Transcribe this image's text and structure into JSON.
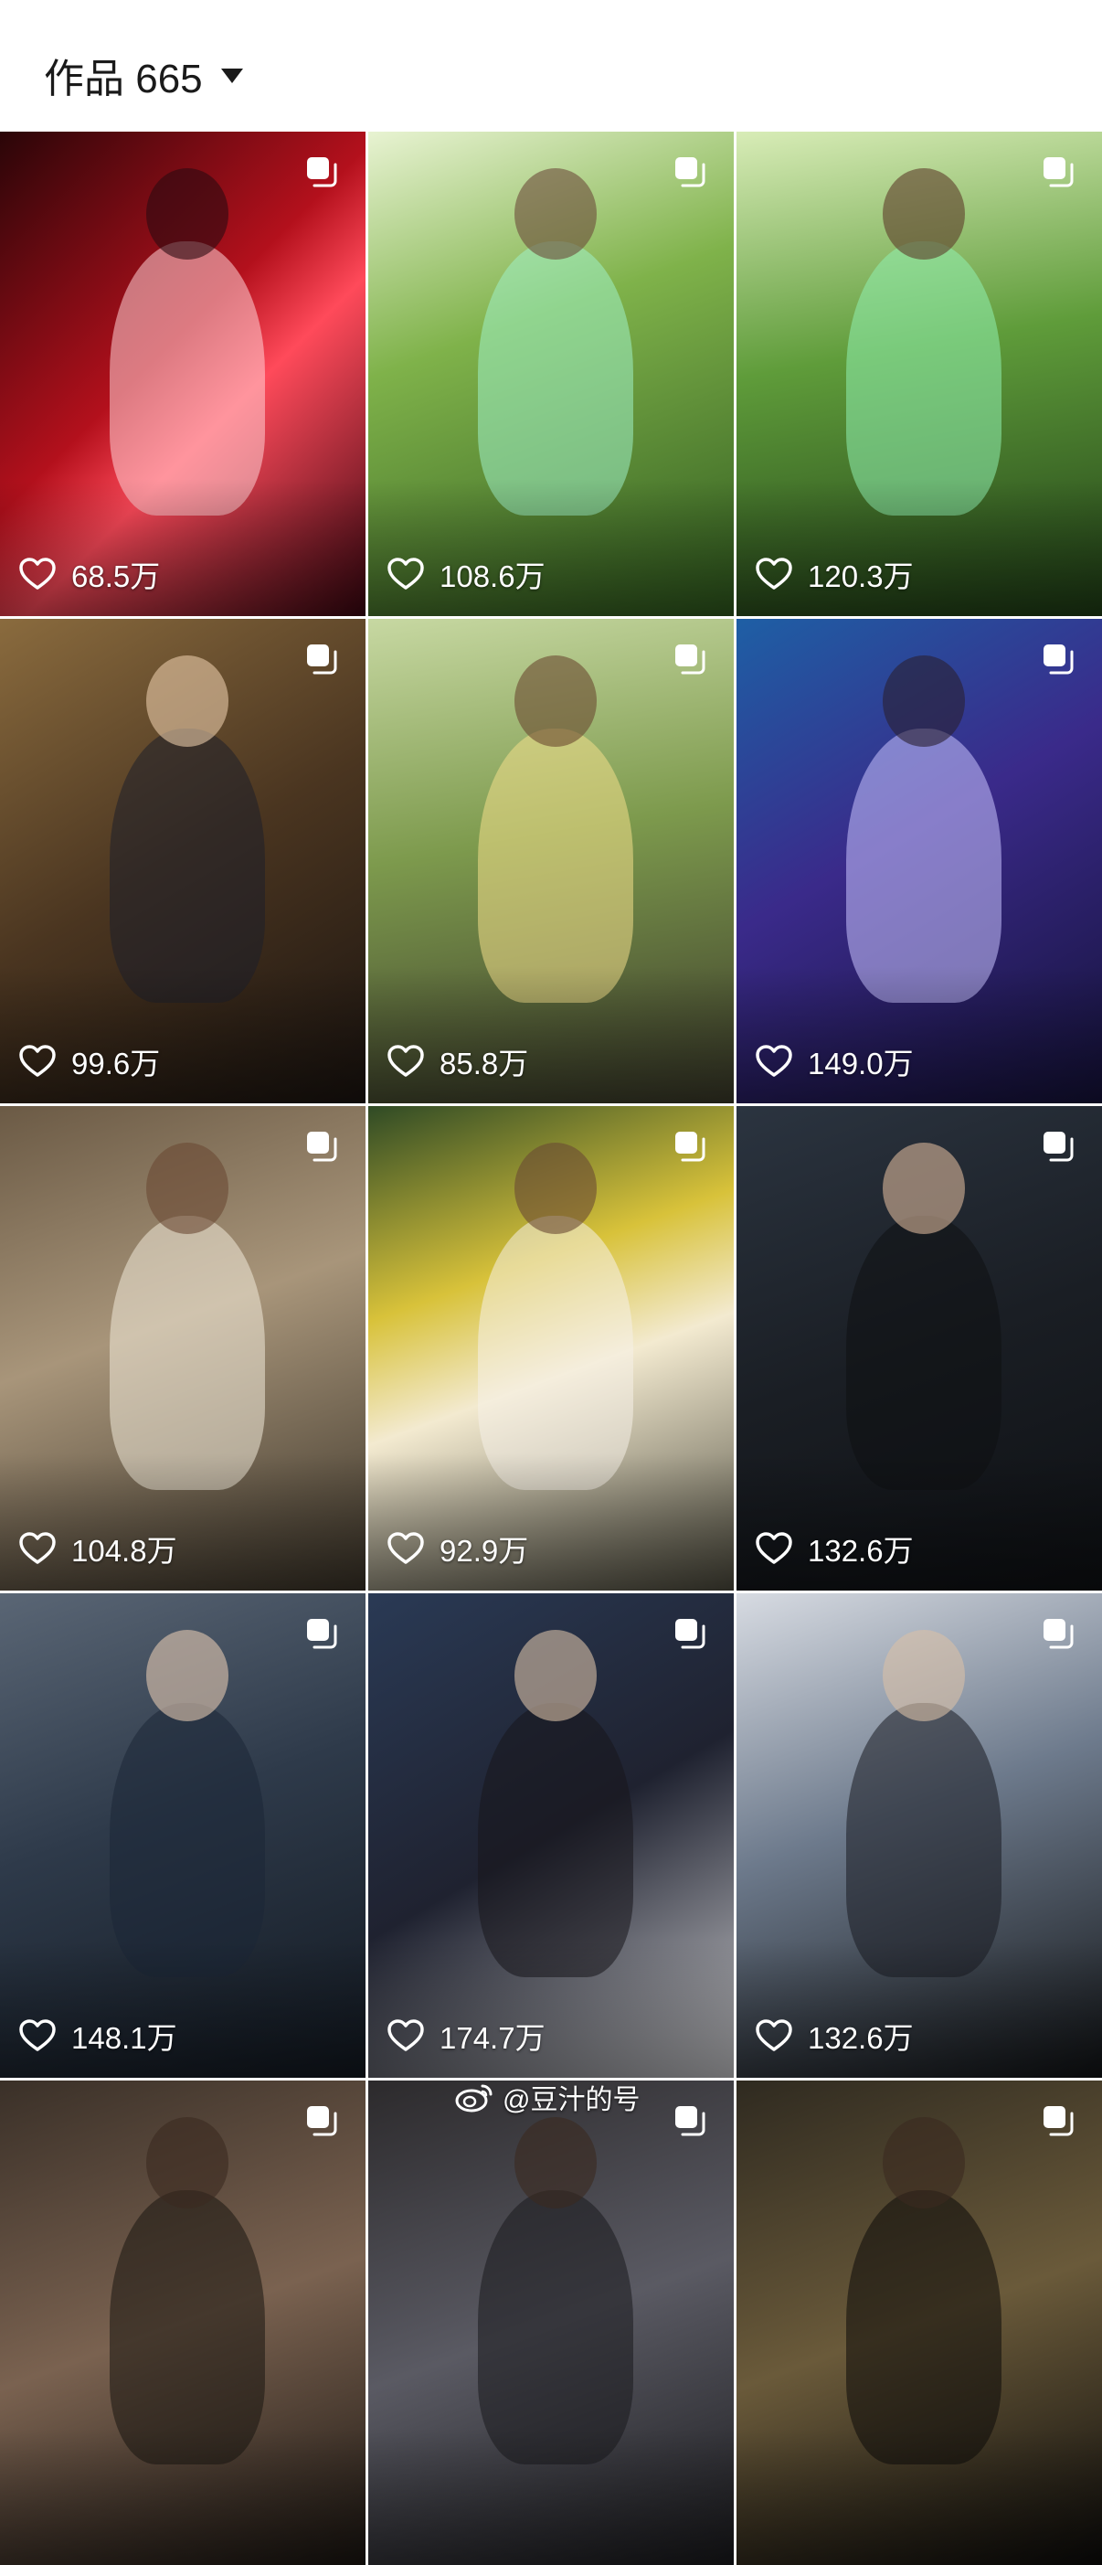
{
  "header": {
    "title": "作品 665"
  },
  "tiles": [
    {
      "likes": "68.5万",
      "bg": "linear-gradient(135deg,#2a0508 0%,#b3101c 45%,#ff4a5a 60%,#3a0610 100%)",
      "tone": "#ffd1d6",
      "shade": "#2b0a10"
    },
    {
      "likes": "108.6万",
      "bg": "linear-gradient(160deg,#e8f3d2 0%,#7fb24a 40%,#2f5a1e 100%)",
      "tone": "#9ff0c7",
      "shade": "#6c4b3a"
    },
    {
      "likes": "120.3万",
      "bg": "linear-gradient(170deg,#d8ecb7 0%,#5f9c3a 45%,#1f3d16 100%)",
      "tone": "#8ff0b0",
      "shade": "#5d3c2a"
    },
    {
      "likes": "99.6万",
      "bg": "linear-gradient(150deg,#8a6b3e 0%,#4a3520 50%,#1b1410 100%)",
      "tone": "#1d1f2a",
      "shade": "#e8c9a8"
    },
    {
      "likes": "85.8万",
      "bg": "linear-gradient(170deg,#c7d8a2 0%,#7d9a4d 45%,#3b3a2a 100%)",
      "tone": "#f2df8a",
      "shade": "#6b4a30"
    },
    {
      "likes": "149.0万",
      "bg": "linear-gradient(150deg,#1e5fa5 0%,#3a2a8a 45%,#15123a 100%)",
      "tone": "#c9c2ff",
      "shade": "#2a2030"
    },
    {
      "likes": "104.8万",
      "bg": "linear-gradient(160deg,#6b5a45 0%,#a8957a 45%,#3a3328 100%)",
      "tone": "#f1ead9",
      "shade": "#6a4a33"
    },
    {
      "likes": "92.9万",
      "bg": "linear-gradient(160deg,#2f4a25 0%,#d8c23a 35%,#f3ead0 55%,#4c4a3d 100%)",
      "tone": "#f5f1e8",
      "shade": "#6a4a33"
    },
    {
      "likes": "132.6万",
      "bg": "linear-gradient(160deg,#2b3440 0%,#1a1e24 50%,#0e1013 100%)",
      "tone": "#0f1012",
      "shade": "#d8b69a"
    },
    {
      "likes": "148.1万",
      "bg": "linear-gradient(160deg,#5a6675 0%,#2e3a4a 45%,#121820 100%)",
      "tone": "#1c2636",
      "shade": "#e2c8b0"
    },
    {
      "likes": "174.7万",
      "bg": "linear-gradient(150deg,#2a3a55 0%,#1f2230 50%,#c9c9cc 100%)",
      "tone": "#17161b",
      "shade": "#d9bfa7"
    },
    {
      "likes": "132.6万",
      "bg": "linear-gradient(160deg,#d7dbe2 0%,#6d7a8c 45%,#111315 100%)",
      "tone": "#1a1c22",
      "shade": "#d9bfa7"
    },
    {
      "likes": "",
      "bg": "linear-gradient(160deg,#3a3028 0%,#7a6250 50%,#1a1511 100%)",
      "tone": "#1a1511",
      "shade": "#3a2a20"
    },
    {
      "likes": "",
      "bg": "linear-gradient(160deg,#2c2a2c 0%,#5a5a63 50%,#1a1a1d 100%)",
      "tone": "#1a1a1d",
      "shade": "#3a2a20"
    },
    {
      "likes": "",
      "bg": "linear-gradient(160deg,#2f2a20 0%,#6a5a3a 50%,#0c0b0a 100%)",
      "tone": "#0c0b0a",
      "shade": "#3a2a20"
    }
  ],
  "watermark": {
    "text": "@豆汁的号"
  }
}
